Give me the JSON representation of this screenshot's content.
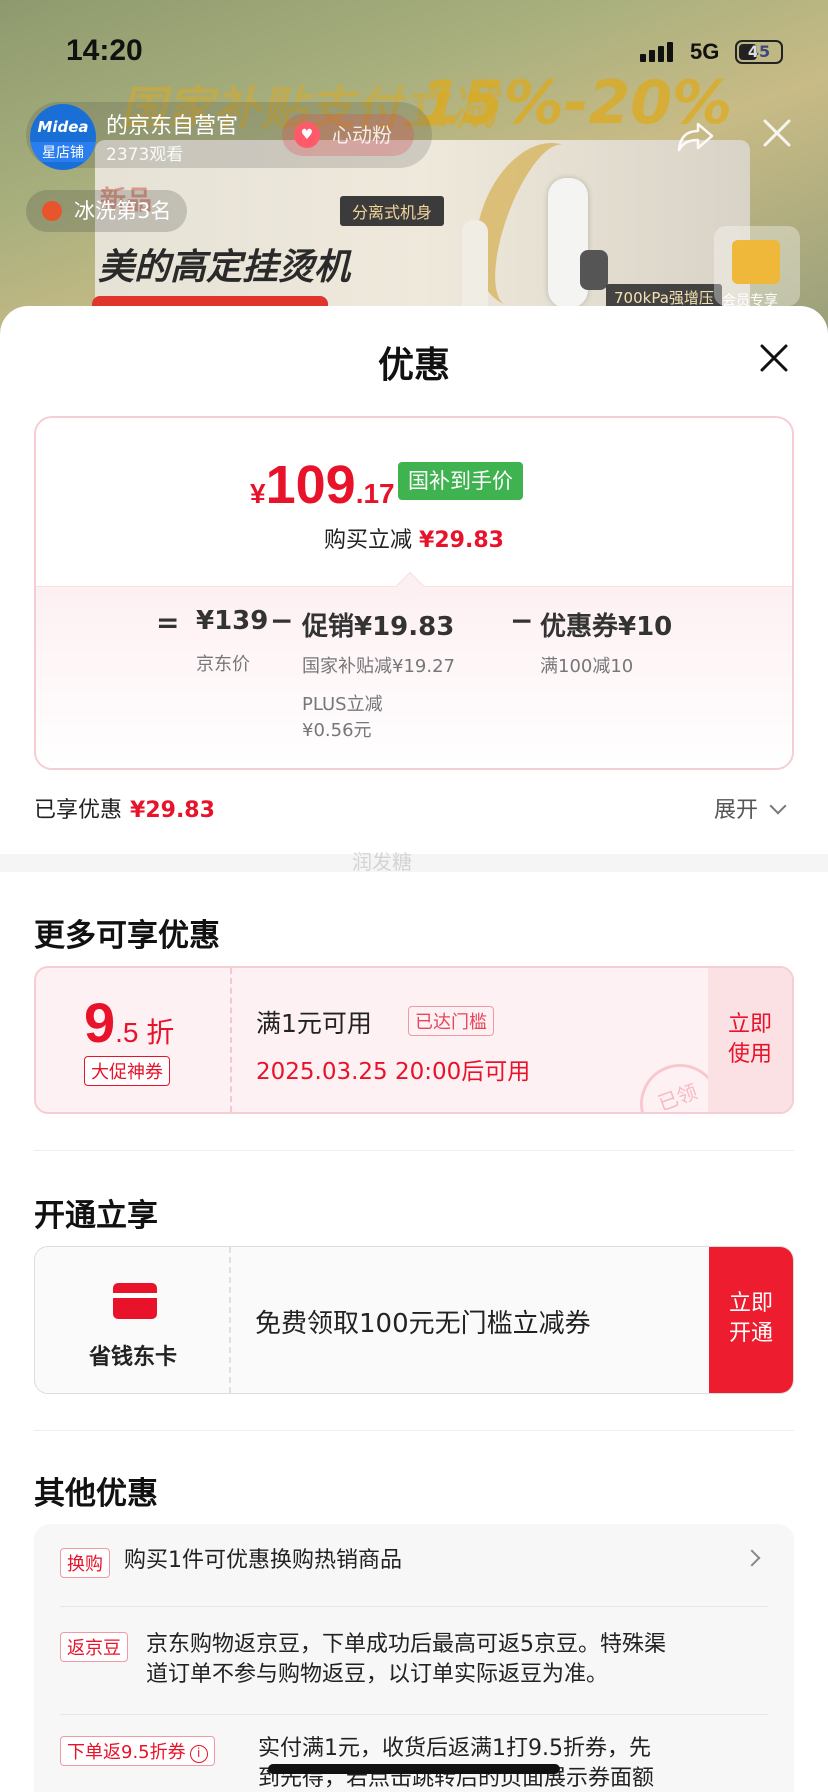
{
  "status_bar": {
    "time": "14:20",
    "network": "5G",
    "battery": "45",
    "battery_level": 0.45
  },
  "live": {
    "shop_logo_brand": "Midea",
    "shop_logo_tag": "星店铺",
    "shop_name": "的京东自营官",
    "viewers": "2373观看",
    "fans_button": "心动粉",
    "rank": "冰洗第3名",
    "banner_headline": "国家补贴支付立减",
    "banner_percent": "15%-20%",
    "banner_product": "美的高定挂烫机",
    "banner_new": "新品",
    "banner_tag_split": "分离式机身",
    "banner_tag_pressure": "700kPa强增压",
    "gift_label": "会员专享"
  },
  "sheet": {
    "title": "优惠",
    "price": {
      "currency": "¥",
      "integer": "109",
      "decimal": ".17",
      "badge": "国补到手价"
    },
    "instant_off": {
      "label": "购买立减",
      "amount": "¥29.83"
    },
    "calc": {
      "eq": "=",
      "jd_price": "¥139",
      "jd_price_label": "京东价",
      "minus1": "−",
      "promo": "促销¥19.83",
      "promo_detail1": "国家补贴减¥19.27",
      "promo_detail2a": "PLUS立减",
      "promo_detail2b": "¥0.56元",
      "minus2": "−",
      "coupon": "优惠券¥10",
      "coupon_detail": "满100减10"
    },
    "enjoyed": {
      "label": "已享优惠",
      "amount": "¥29.83"
    },
    "expand_label": "展开",
    "watermark": "润发糖",
    "more_title": "更多可享优惠",
    "coupon_card": {
      "discount_int": "9",
      "discount_suffix": ".5 折",
      "type": "大促神券",
      "condition": "满1元可用",
      "reached": "已达门槛",
      "available": "2025.03.25 20:00后可用",
      "action_line1": "立即",
      "action_line2": "使用",
      "stamp": "已领"
    },
    "open_title": "开通立享",
    "open_card": {
      "name": "省钱东卡",
      "desc": "免费领取100元无门槛立减券",
      "action_line1": "立即",
      "action_line2": "开通"
    },
    "other_title": "其他优惠",
    "other_items": [
      {
        "tag": "换购",
        "text": "购买1件可优惠换购热销商品"
      },
      {
        "tag": "返京豆",
        "text_line1": "京东购物返京豆，下单成功后最高可返5京豆。特殊渠",
        "text_line2": "道订单不参与购物返豆，以订单实际返豆为准。"
      },
      {
        "tag": "下单返9.5折券",
        "tag_icon": "i",
        "text_line1": "实付满1元，收货后返满1打9.5折券，先",
        "text_line2": "到先得，若点击跳转后的页面展示券面额"
      }
    ]
  }
}
